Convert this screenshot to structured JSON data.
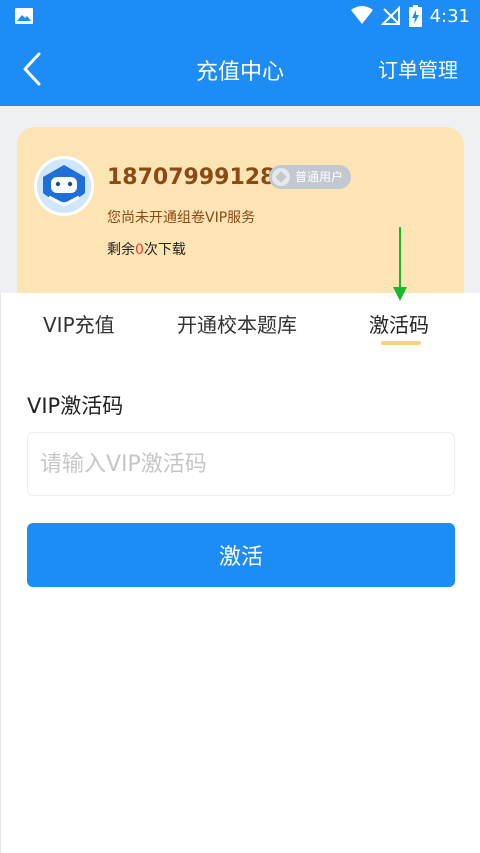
{
  "status_bar": {
    "time": "4:31"
  },
  "app_bar": {
    "title": "充值中心",
    "right_action": "订单管理"
  },
  "user_card": {
    "phone": "18707999128",
    "badge": "普通用户",
    "vip_note": "您尚未开通组卷VIP服务",
    "remain_prefix": "剩余",
    "remain_count": "0",
    "remain_suffix": "次下载"
  },
  "tabs": [
    {
      "label": "VIP充值"
    },
    {
      "label": "开通校本题库"
    },
    {
      "label": "激活码"
    }
  ],
  "active_tab": "激活码",
  "activation": {
    "label": "VIP激活码",
    "placeholder": "请输入VIP激活码",
    "button": "激活"
  },
  "colors": {
    "primary": "#1e8cf5",
    "card_bg": "#fde4b5",
    "text_brown": "#8a4a14",
    "remain_count": "#ff3b30",
    "tab_indicator": "#fdd27a",
    "annotation_arrow": "#1bb82c"
  }
}
